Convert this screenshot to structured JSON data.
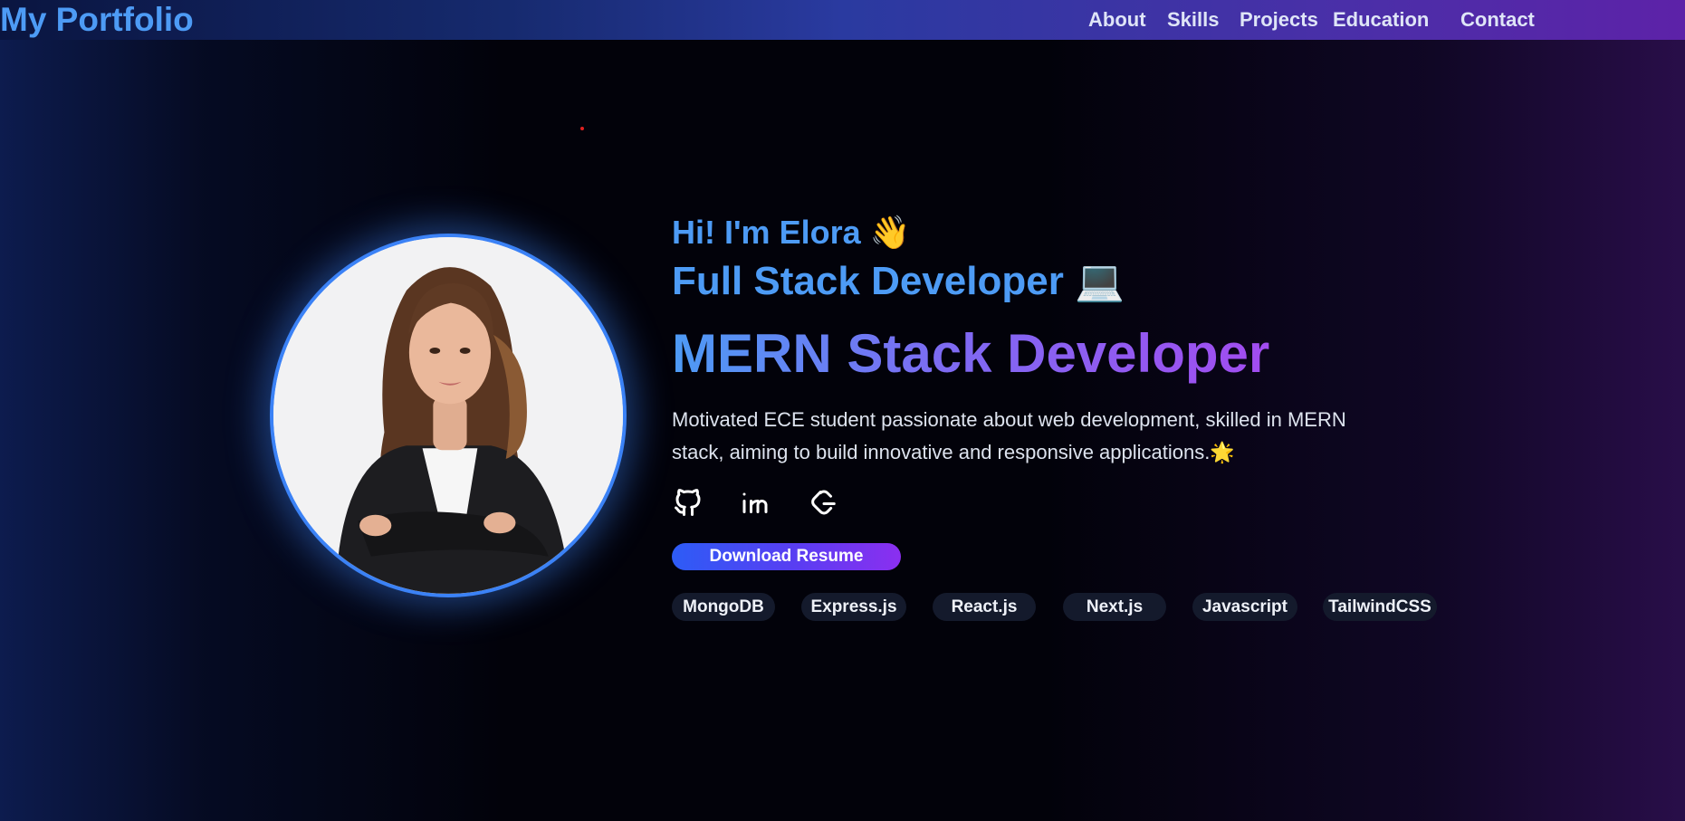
{
  "nav": {
    "brand": "My Portfolio",
    "links": [
      "About",
      "Skills",
      "Projects",
      "Education",
      "Contact"
    ]
  },
  "hero": {
    "greeting": "Hi! I'm Elora 👋",
    "role": "Full Stack Developer 💻",
    "headline": "MERN Stack Developer",
    "bio": "Motivated ECE student passionate about web development, skilled in MERN stack, aiming to build innovative and responsive applications.🌟",
    "socials": [
      "github-icon",
      "linkedin-icon",
      "leetcode-icon"
    ],
    "resume_button": "Download Resume",
    "tags": [
      "MongoDB",
      "Express.js",
      "React.js",
      "Next.js",
      "Javascript",
      "TailwindCSS"
    ]
  },
  "colors": {
    "accent_blue": "#4d9bf5",
    "accent_purple": "#a24cf0",
    "avatar_ring": "#3b82f6"
  }
}
